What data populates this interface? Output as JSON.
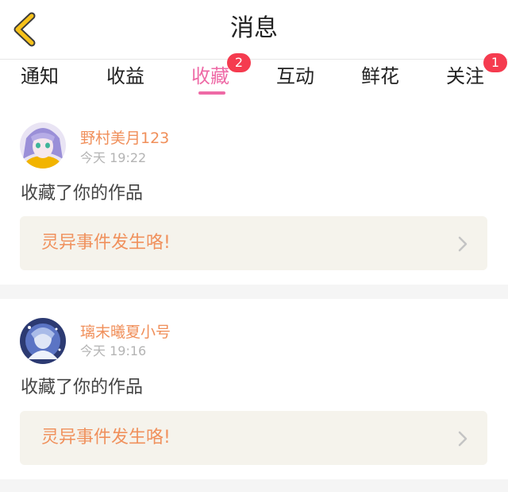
{
  "header": {
    "title": "消息",
    "back_icon": "chevron-left-icon"
  },
  "tabs": [
    {
      "label": "通知",
      "active": false,
      "badge": ""
    },
    {
      "label": "收益",
      "active": false,
      "badge": ""
    },
    {
      "label": "收藏",
      "active": true,
      "badge": "2"
    },
    {
      "label": "互动",
      "active": false,
      "badge": ""
    },
    {
      "label": "鲜花",
      "active": false,
      "badge": ""
    },
    {
      "label": "关注",
      "active": false,
      "badge": "1"
    }
  ],
  "messages": [
    {
      "username": "野村美月123",
      "time": "今天 19:22",
      "action": "收藏了你的作品",
      "work_title": "灵异事件发生咯!"
    },
    {
      "username": "璃末曦夏小号",
      "time": "今天 19:16",
      "action": "收藏了你的作品",
      "work_title": "灵异事件发生咯!"
    }
  ],
  "colors": {
    "accent_pink": "#ee6aa6",
    "badge_red": "#f53b4f",
    "username_orange": "#f08f5a",
    "back_icon_yellow": "#f7c21b",
    "card_box_bg": "#f5f3ec"
  }
}
